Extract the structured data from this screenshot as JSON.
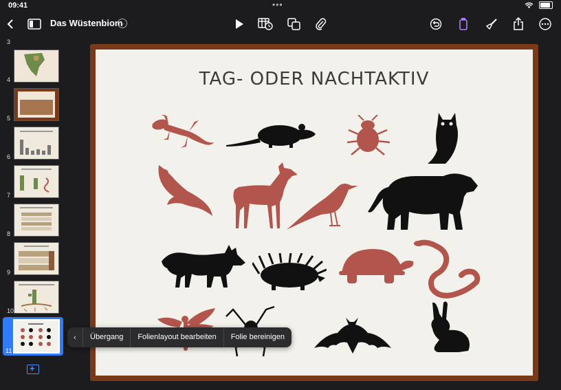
{
  "status_bar": {
    "time": "09:41"
  },
  "document": {
    "title": "Das Wüstenbiom"
  },
  "colors": {
    "accent": "#2f7cf6",
    "slide_border": "#7a3a1a",
    "red_animal": "#b2554c",
    "dark_animal": "#111111"
  },
  "navigator": {
    "slides": [
      {
        "number": "3"
      },
      {
        "number": "4"
      },
      {
        "number": "5"
      },
      {
        "number": "6"
      },
      {
        "number": "7"
      },
      {
        "number": "8"
      },
      {
        "number": "9"
      },
      {
        "number": "10"
      },
      {
        "number": "11"
      }
    ]
  },
  "slide": {
    "title": "TAG- ODER NACHTAKTIV",
    "animals": [
      {
        "name": "gecko",
        "color": "red"
      },
      {
        "name": "rat",
        "color": "dark"
      },
      {
        "name": "beetle",
        "color": "red"
      },
      {
        "name": "owl",
        "color": "dark"
      },
      {
        "name": "hawk",
        "color": "red"
      },
      {
        "name": "deer",
        "color": "red"
      },
      {
        "name": "bird",
        "color": "red"
      },
      {
        "name": "mountain-lion",
        "color": "dark"
      },
      {
        "name": "fox",
        "color": "dark"
      },
      {
        "name": "porcupine",
        "color": "dark"
      },
      {
        "name": "tortoise",
        "color": "red"
      },
      {
        "name": "snake",
        "color": "red"
      },
      {
        "name": "dragonfly",
        "color": "red"
      },
      {
        "name": "spider",
        "color": "dark"
      },
      {
        "name": "bat",
        "color": "dark"
      },
      {
        "name": "rabbit",
        "color": "dark"
      }
    ]
  },
  "context_menu": {
    "items": [
      "Übergang",
      "Folienlayout bearbeiten",
      "Folie bereinigen"
    ]
  }
}
